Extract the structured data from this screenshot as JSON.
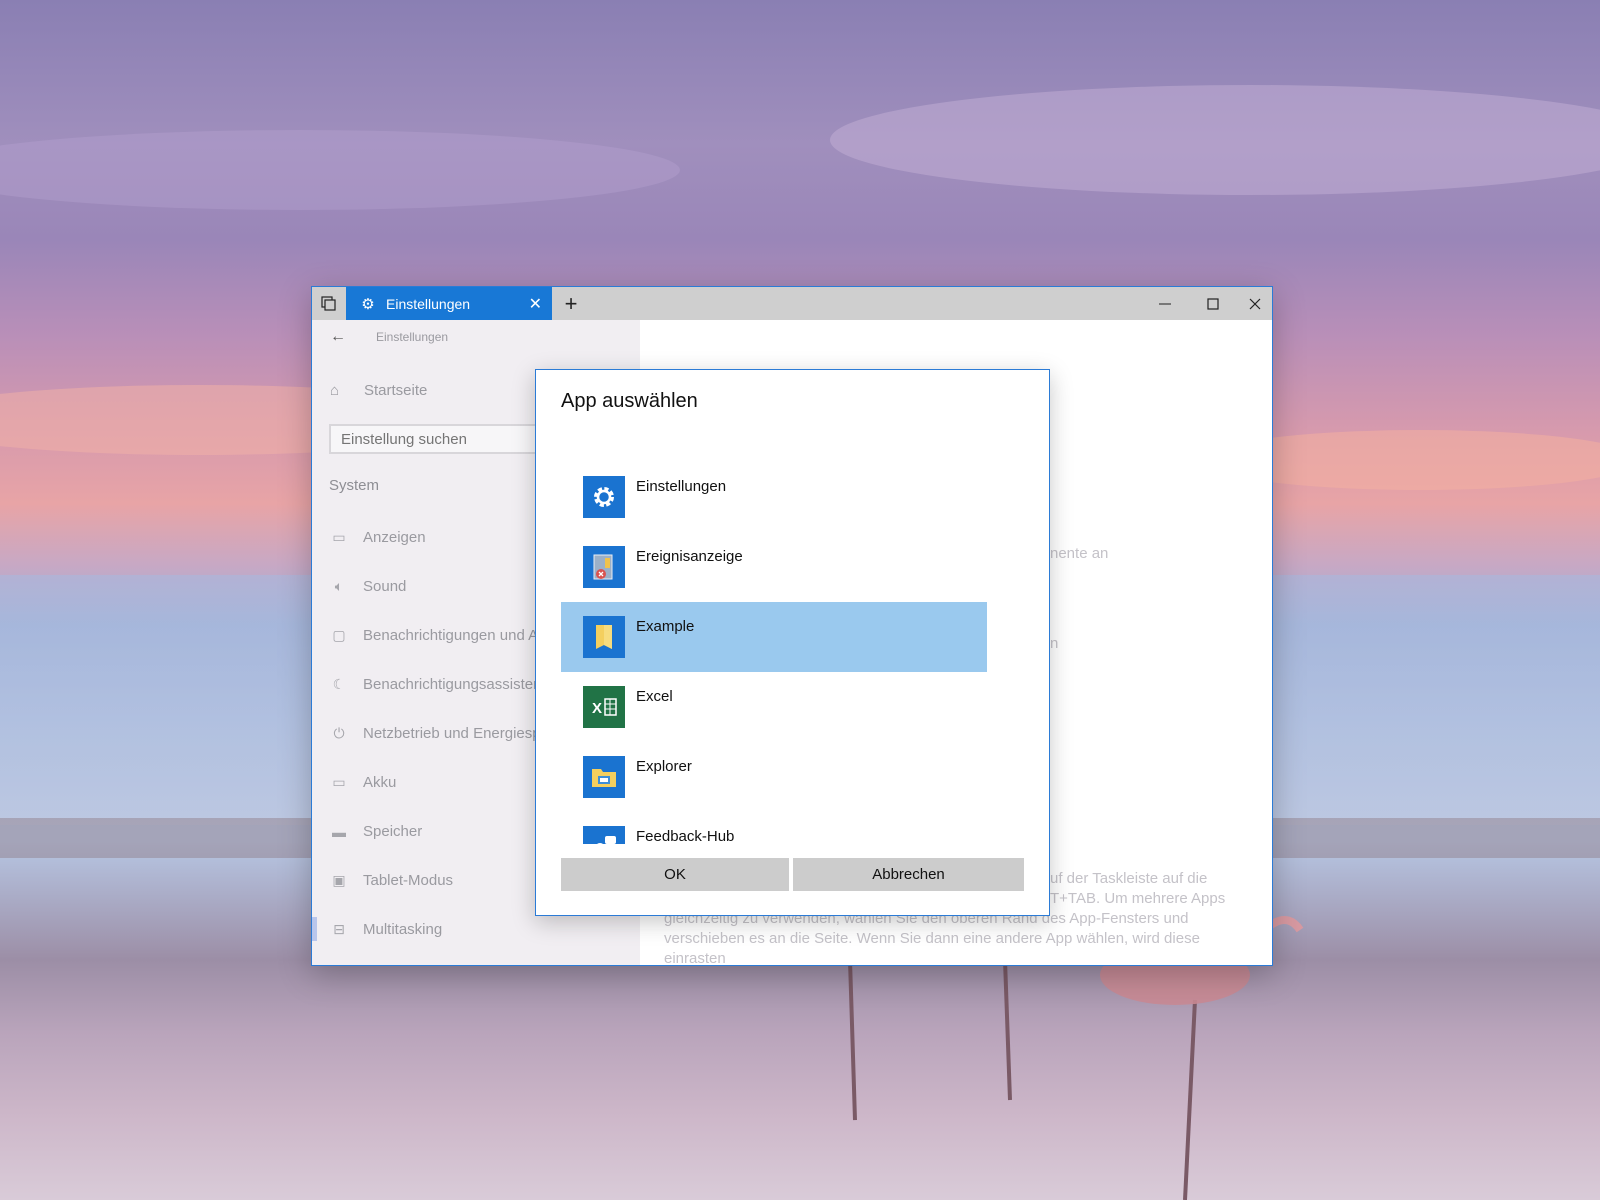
{
  "window": {
    "tab_title": "Einstellungen",
    "breadcrumb": "Einstellungen"
  },
  "sidebar": {
    "home_label": "Startseite",
    "search_placeholder": "Einstellung suchen",
    "section_title": "System",
    "items": [
      {
        "label": "Anzeigen",
        "icon": "monitor-icon"
      },
      {
        "label": "Sound",
        "icon": "speaker-icon"
      },
      {
        "label": "Benachrichtigungen und A",
        "icon": "notification-icon"
      },
      {
        "label": "Benachrichtigungsassisten",
        "icon": "moon-icon"
      },
      {
        "label": "Netzbetrieb und Energiesp",
        "icon": "power-icon"
      },
      {
        "label": "Akku",
        "icon": "battery-icon"
      },
      {
        "label": "Speicher",
        "icon": "storage-icon"
      },
      {
        "label": "Tablet-Modus",
        "icon": "tablet-icon"
      },
      {
        "label": "Multitasking",
        "icon": "multitasking-icon"
      }
    ]
  },
  "content": {
    "fragment_1": "nente an",
    "fragment_2": "n",
    "paragraph_lines": [
      "uf der Taskleiste auf die",
      "T+TAB. Um mehrere Apps",
      "gleichzeitig zu verwenden, wählen Sie den oberen Rand des App-Fensters und",
      "verschieben es an die Seite. Wenn Sie dann eine andere App wählen, wird diese",
      "einrasten"
    ]
  },
  "dialog": {
    "title": "App auswählen",
    "apps": [
      {
        "name": "Einstellungen",
        "icon": "gear-icon",
        "color": "#1a73d0"
      },
      {
        "name": "Ereignisanzeige",
        "icon": "event-viewer-icon",
        "color": "#1a73d0"
      },
      {
        "name": "Example",
        "icon": "folder-note-icon",
        "color": "#1a73d0"
      },
      {
        "name": "Excel",
        "icon": "excel-icon",
        "color": "#217346"
      },
      {
        "name": "Explorer",
        "icon": "file-explorer-icon",
        "color": "#1a73d0"
      },
      {
        "name": "Feedback-Hub",
        "icon": "feedback-hub-icon",
        "color": "#1a73d0"
      }
    ],
    "selected_app": "Example",
    "ok_label": "OK",
    "cancel_label": "Abbrechen"
  }
}
